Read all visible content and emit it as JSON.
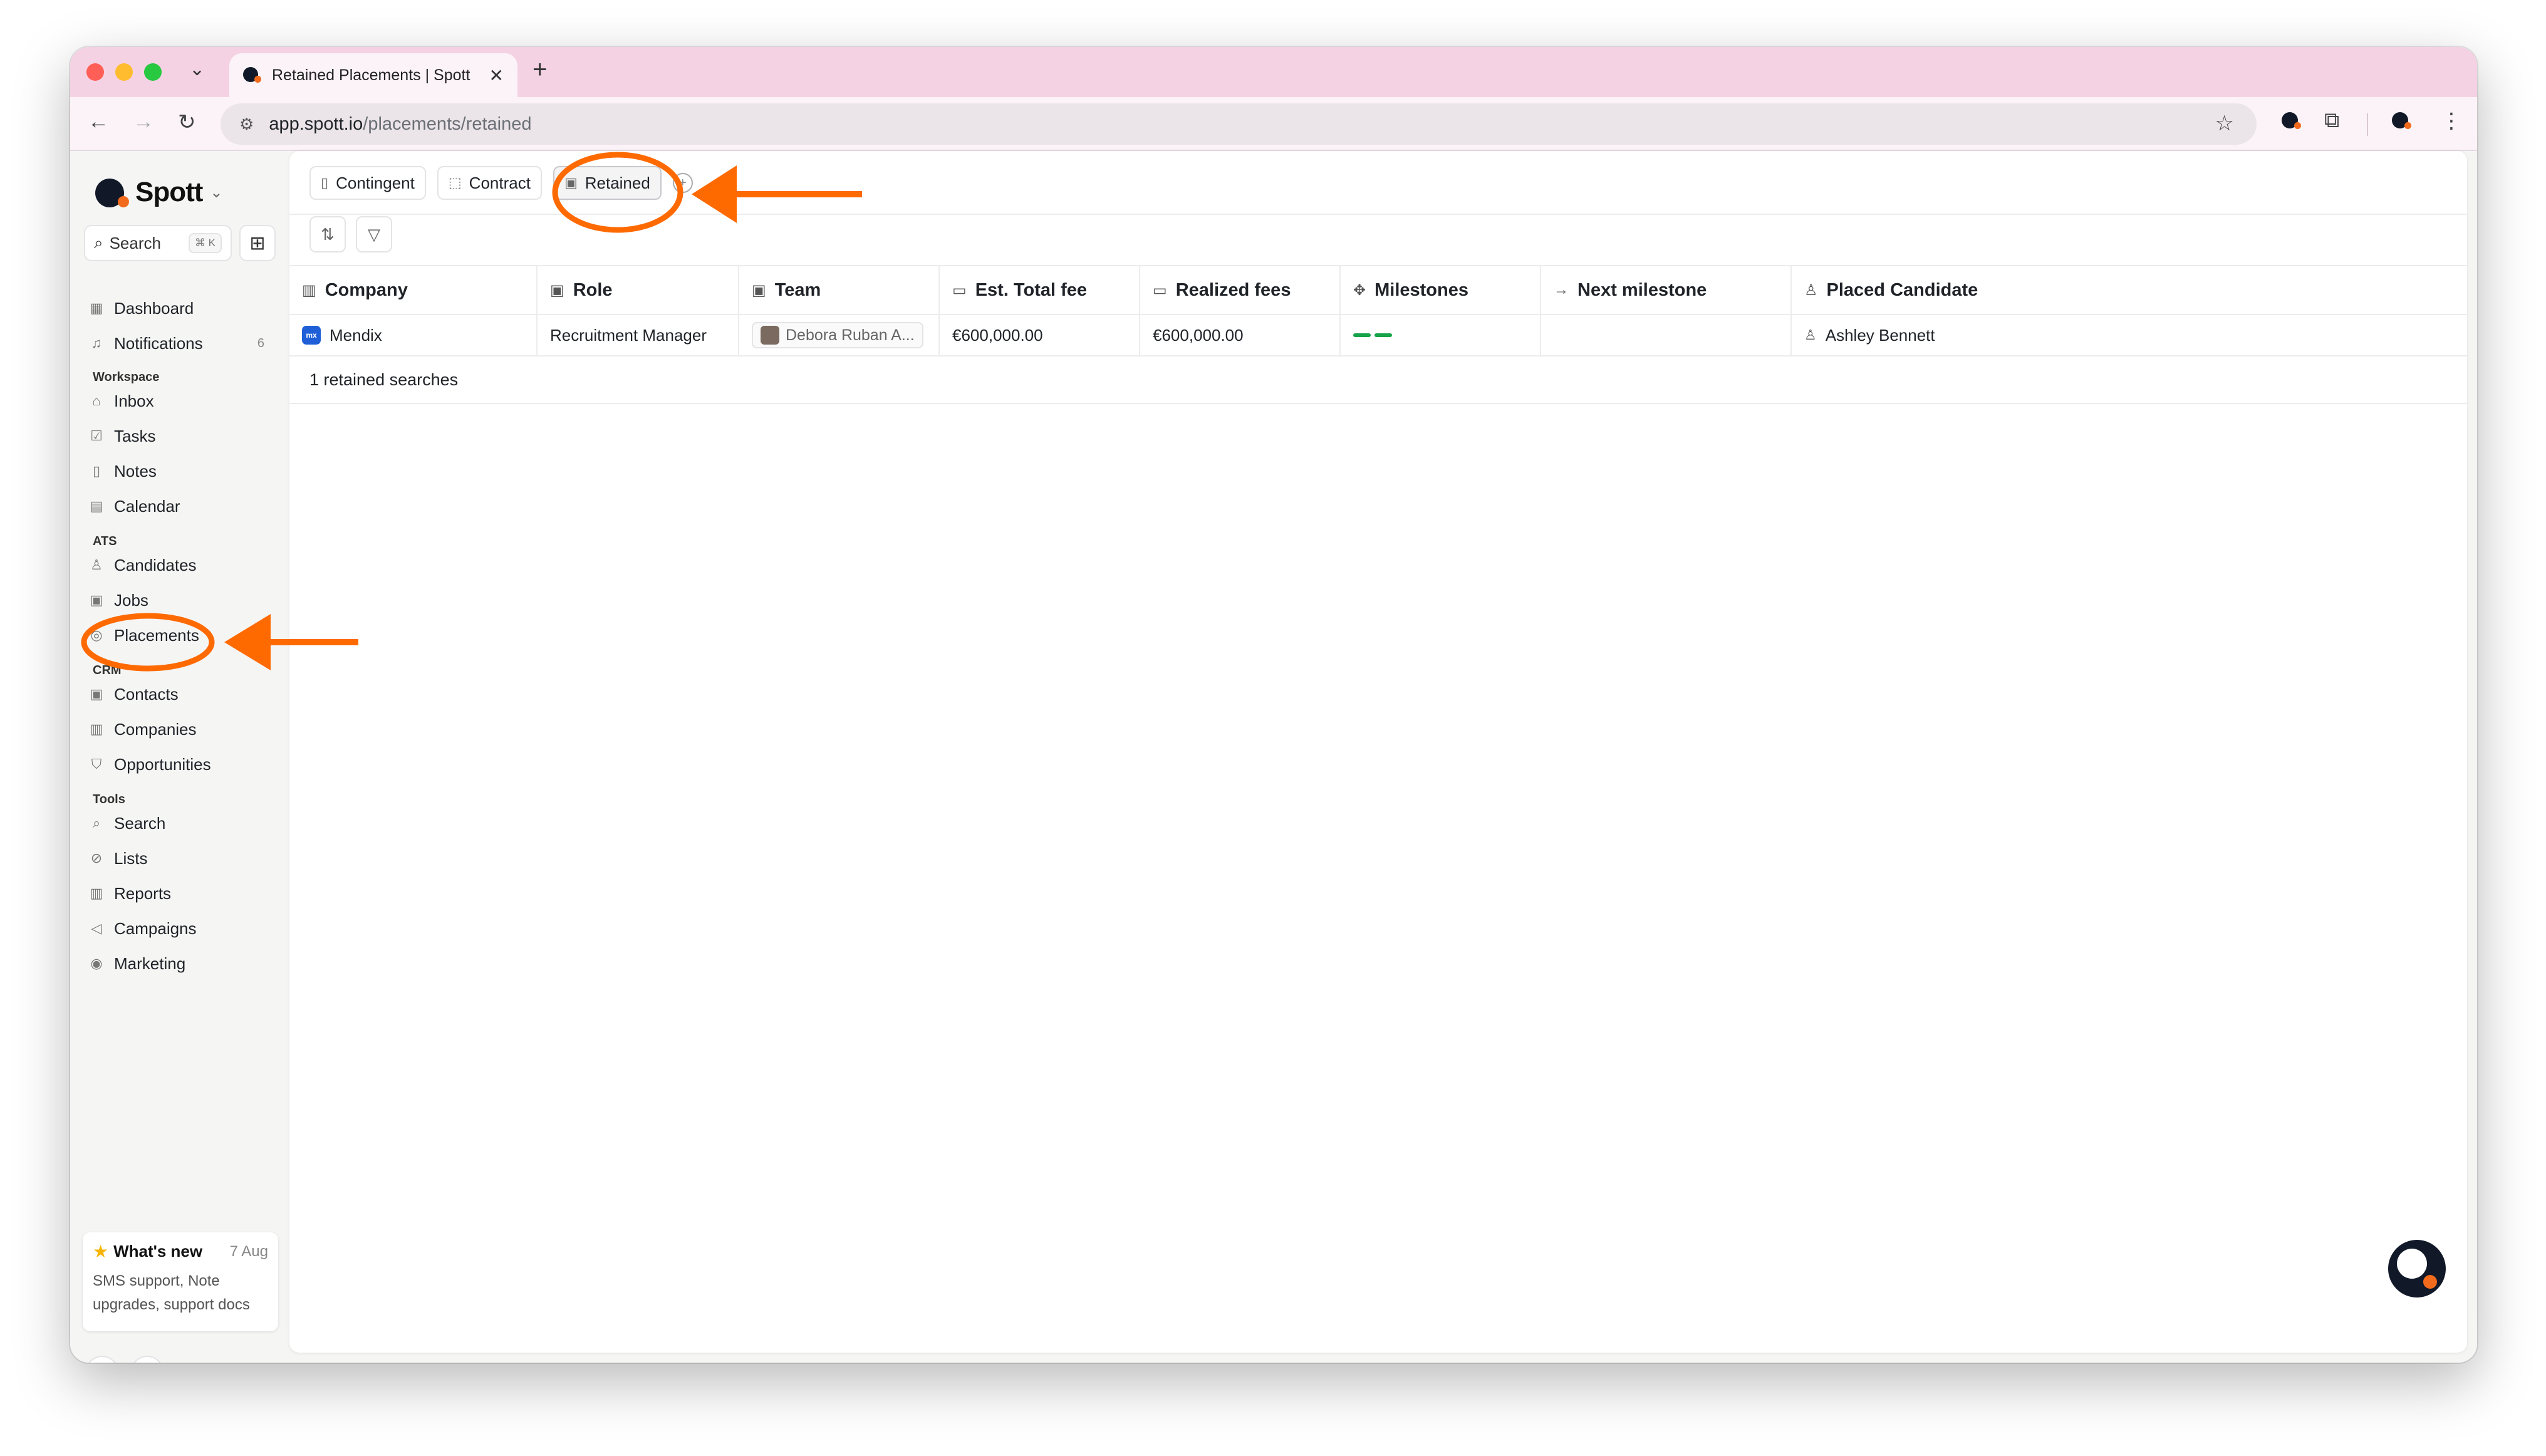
{
  "browser": {
    "tab_title": "Retained Placements | Spott",
    "url_host": "app.spott.io",
    "url_path": "/placements/retained"
  },
  "sidebar": {
    "brand": "Spott",
    "search_label": "Search",
    "search_shortcut": "⌘ K",
    "top_items": [
      {
        "label": "Dashboard",
        "icon": "dashboard-icon"
      },
      {
        "label": "Notifications",
        "icon": "bell-icon",
        "count": "6"
      }
    ],
    "sections": {
      "workspace": "Workspace",
      "ats": "ATS",
      "crm": "CRM",
      "tools": "Tools"
    },
    "workspace_items": [
      {
        "label": "Inbox",
        "icon": "inbox-icon"
      },
      {
        "label": "Tasks",
        "icon": "checkbox-icon"
      },
      {
        "label": "Notes",
        "icon": "note-icon"
      },
      {
        "label": "Calendar",
        "icon": "calendar-icon"
      }
    ],
    "ats_items": [
      {
        "label": "Candidates",
        "icon": "person-icon"
      },
      {
        "label": "Jobs",
        "icon": "clipboard-icon"
      },
      {
        "label": "Placements",
        "icon": "medal-icon"
      }
    ],
    "crm_items": [
      {
        "label": "Contacts",
        "icon": "contact-icon"
      },
      {
        "label": "Companies",
        "icon": "building-icon"
      },
      {
        "label": "Opportunities",
        "icon": "shield-icon"
      }
    ],
    "tools_items": [
      {
        "label": "Search",
        "icon": "search-icon"
      },
      {
        "label": "Lists",
        "icon": "list-icon"
      },
      {
        "label": "Reports",
        "icon": "chart-icon"
      },
      {
        "label": "Campaigns",
        "icon": "megaphone-icon"
      },
      {
        "label": "Marketing",
        "icon": "target-icon"
      }
    ],
    "whats_new": {
      "title": "What's new",
      "date": "7 Aug",
      "body": "SMS support, Note upgrades, support docs"
    }
  },
  "views": {
    "tabs": [
      {
        "label": "Contingent",
        "active": false
      },
      {
        "label": "Contract",
        "active": false
      },
      {
        "label": "Retained",
        "active": true
      }
    ]
  },
  "table": {
    "columns": [
      "Company",
      "Role",
      "Team",
      "Est. Total fee",
      "Realized fees",
      "Milestones",
      "Next milestone",
      "Placed Candidate"
    ],
    "rows": [
      {
        "company": "Mendix",
        "role": "Recruitment Manager",
        "team": "Debora Ruban A...",
        "est_total_fee": "€600,000.00",
        "realized_fees": "€600,000.00",
        "milestones_completed": 2,
        "next_milestone": "",
        "placed_candidate": "Ashley Bennett"
      }
    ],
    "footer": "1 retained searches"
  },
  "colors": {
    "brand_dark": "#111827",
    "brand_orange": "#f26b1d",
    "annotation": "#ff6a00",
    "milestone": "#16a34a",
    "tabstrip": "#f4d2e3"
  }
}
